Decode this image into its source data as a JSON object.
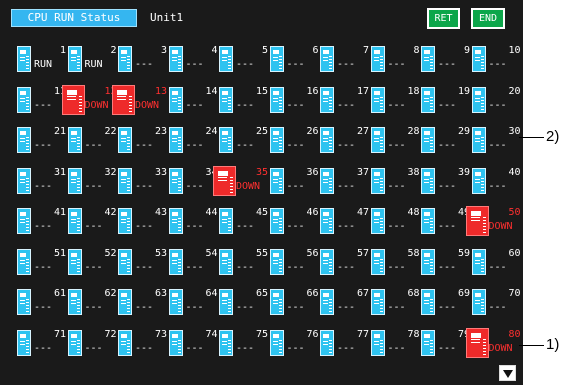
{
  "header": {
    "title": "CPU RUN Status",
    "unit": "Unit1",
    "ret_label": "RET",
    "end_label": "END"
  },
  "cpus": [
    {
      "id": "1",
      "status": "RUN"
    },
    {
      "id": "2",
      "status": "RUN"
    },
    {
      "id": "3",
      "status": "---"
    },
    {
      "id": "4",
      "status": "---"
    },
    {
      "id": "5",
      "status": "---"
    },
    {
      "id": "6",
      "status": "---"
    },
    {
      "id": "7",
      "status": "---"
    },
    {
      "id": "8",
      "status": "---"
    },
    {
      "id": "9",
      "status": "---"
    },
    {
      "id": "10",
      "status": "---"
    },
    {
      "id": "11",
      "status": "---"
    },
    {
      "id": "12",
      "status": "DOWN"
    },
    {
      "id": "13",
      "status": "DOWN"
    },
    {
      "id": "14",
      "status": "---"
    },
    {
      "id": "15",
      "status": "---"
    },
    {
      "id": "16",
      "status": "---"
    },
    {
      "id": "17",
      "status": "---"
    },
    {
      "id": "18",
      "status": "---"
    },
    {
      "id": "19",
      "status": "---"
    },
    {
      "id": "20",
      "status": "---"
    },
    {
      "id": "21",
      "status": "---"
    },
    {
      "id": "22",
      "status": "---"
    },
    {
      "id": "23",
      "status": "---"
    },
    {
      "id": "24",
      "status": "---"
    },
    {
      "id": "25",
      "status": "---"
    },
    {
      "id": "26",
      "status": "---"
    },
    {
      "id": "27",
      "status": "---"
    },
    {
      "id": "28",
      "status": "---"
    },
    {
      "id": "29",
      "status": "---"
    },
    {
      "id": "30",
      "status": "---"
    },
    {
      "id": "31",
      "status": "---"
    },
    {
      "id": "32",
      "status": "---"
    },
    {
      "id": "33",
      "status": "---"
    },
    {
      "id": "34",
      "status": "---"
    },
    {
      "id": "35",
      "status": "DOWN"
    },
    {
      "id": "36",
      "status": "---"
    },
    {
      "id": "37",
      "status": "---"
    },
    {
      "id": "38",
      "status": "---"
    },
    {
      "id": "39",
      "status": "---"
    },
    {
      "id": "40",
      "status": "---"
    },
    {
      "id": "41",
      "status": "---"
    },
    {
      "id": "42",
      "status": "---"
    },
    {
      "id": "43",
      "status": "---"
    },
    {
      "id": "44",
      "status": "---"
    },
    {
      "id": "45",
      "status": "---"
    },
    {
      "id": "46",
      "status": "---"
    },
    {
      "id": "47",
      "status": "---"
    },
    {
      "id": "48",
      "status": "---"
    },
    {
      "id": "49",
      "status": "---"
    },
    {
      "id": "50",
      "status": "DOWN"
    },
    {
      "id": "51",
      "status": "---"
    },
    {
      "id": "52",
      "status": "---"
    },
    {
      "id": "53",
      "status": "---"
    },
    {
      "id": "54",
      "status": "---"
    },
    {
      "id": "55",
      "status": "---"
    },
    {
      "id": "56",
      "status": "---"
    },
    {
      "id": "57",
      "status": "---"
    },
    {
      "id": "58",
      "status": "---"
    },
    {
      "id": "59",
      "status": "---"
    },
    {
      "id": "60",
      "status": "---"
    },
    {
      "id": "61",
      "status": "---"
    },
    {
      "id": "62",
      "status": "---"
    },
    {
      "id": "63",
      "status": "---"
    },
    {
      "id": "64",
      "status": "---"
    },
    {
      "id": "65",
      "status": "---"
    },
    {
      "id": "66",
      "status": "---"
    },
    {
      "id": "67",
      "status": "---"
    },
    {
      "id": "68",
      "status": "---"
    },
    {
      "id": "69",
      "status": "---"
    },
    {
      "id": "70",
      "status": "---"
    },
    {
      "id": "71",
      "status": "---"
    },
    {
      "id": "72",
      "status": "---"
    },
    {
      "id": "73",
      "status": "---"
    },
    {
      "id": "74",
      "status": "---"
    },
    {
      "id": "75",
      "status": "---"
    },
    {
      "id": "76",
      "status": "---"
    },
    {
      "id": "77",
      "status": "---"
    },
    {
      "id": "78",
      "status": "---"
    },
    {
      "id": "79",
      "status": "---"
    },
    {
      "id": "80",
      "status": "DOWN"
    }
  ],
  "callouts": {
    "one": "1)",
    "two": "2)"
  },
  "icons": {
    "cpu": "cpu-module-icon",
    "scroll": "triangle-down-icon"
  },
  "colors": {
    "normal": "#2ec3f0",
    "error": "#ee2a2a",
    "button": "#0ca64a",
    "background": "#1a1a1a"
  }
}
